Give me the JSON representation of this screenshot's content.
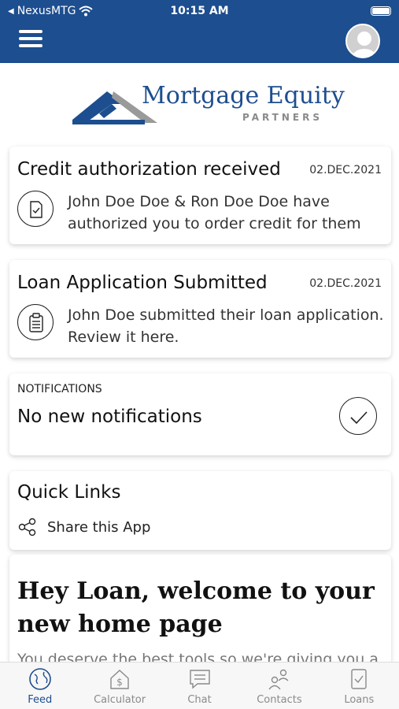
{
  "status_bar": {
    "carrier": "NexusMTG",
    "time": "10:15 AM"
  },
  "header": {
    "menu_icon": "hamburger-icon",
    "avatar_icon": "user-avatar-icon"
  },
  "logo": {
    "name": "Mortgage Equity",
    "tagline": "PARTNERS"
  },
  "feed": [
    {
      "title": "Credit authorization received",
      "date": "02.DEC.2021",
      "body_line1": "John Doe Doe & Ron Doe Doe have",
      "body_line2": "authorized you to order credit for them",
      "icon": "document-check-icon"
    },
    {
      "title": "Loan Application Submitted",
      "date": "02.DEC.2021",
      "body_line1": "John Doe submitted their loan application.",
      "body_line2": "Review it here.",
      "icon": "clipboard-icon"
    }
  ],
  "notifications": {
    "label": "NOTIFICATIONS",
    "text": "No new notifications",
    "icon": "checkmark-circle-icon"
  },
  "quick_links": {
    "title": "Quick Links",
    "share_label": "Share this App",
    "share_icon": "share-icon"
  },
  "welcome": {
    "line1": "Hey Loan, welcome to your",
    "line2": "new home page",
    "body": "You deserve the best tools so we're giving you a"
  },
  "tabs": [
    {
      "label": "Feed",
      "icon": "globe-icon",
      "active": true
    },
    {
      "label": "Calculator",
      "icon": "calculator-icon",
      "active": false
    },
    {
      "label": "Chat",
      "icon": "chat-icon",
      "active": false
    },
    {
      "label": "Contacts",
      "icon": "contacts-icon",
      "active": false
    },
    {
      "label": "Loans",
      "icon": "loans-icon",
      "active": false
    }
  ],
  "colors": {
    "brand": "#1d4e8f",
    "logo_gray": "#9a9a9a"
  }
}
